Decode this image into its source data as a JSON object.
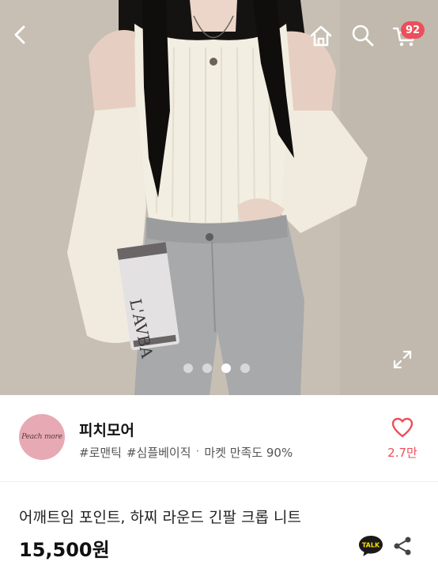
{
  "header": {
    "back_icon": "chevron-left-icon",
    "home_icon": "home-icon",
    "search_icon": "search-icon",
    "cart_icon": "cart-icon",
    "cart_count": "92"
  },
  "gallery": {
    "image_text": "L'AVBA",
    "total_images": 4,
    "active_index": 3,
    "expand_icon": "expand-icon"
  },
  "store": {
    "logo_text": "Peach more",
    "name": "피치모어",
    "tags": [
      "#로맨틱",
      "#심플베이직"
    ],
    "separator": "·",
    "satisfaction": "마켓 만족도 90%",
    "likes": "2.7만",
    "like_icon": "heart-icon"
  },
  "product": {
    "title": "어깨트임 포인트, 하찌 라운드 긴팔 크롭 니트",
    "price": "15,500원",
    "talk_label": "TALK",
    "share_icon": "share-icon"
  },
  "colors": {
    "accent": "#ee4e5b",
    "logo_bg": "#e7a9b3"
  }
}
